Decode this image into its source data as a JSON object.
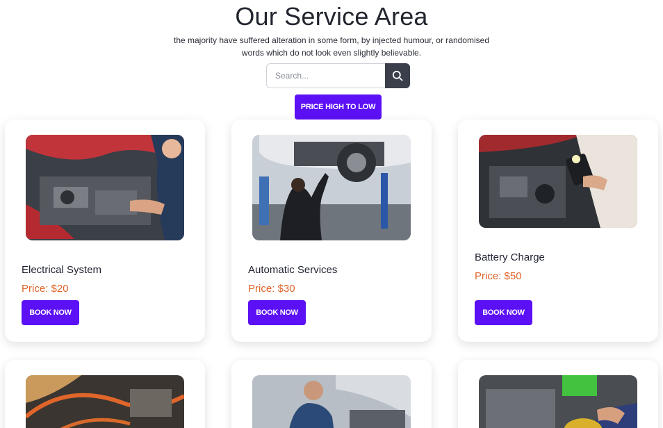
{
  "header": {
    "title": "Our Service Area",
    "subtitle": "the majority have suffered alteration in some form, by injected humour, or randomised words which do not look even slightly believable."
  },
  "search": {
    "placeholder": "Search..."
  },
  "sort": {
    "label": "PRICE HIGH TO LOW"
  },
  "services": [
    {
      "name": "Electrical System",
      "price": "Price: $20",
      "button": "BOOK NOW"
    },
    {
      "name": "Automatic Services",
      "price": "Price: $30",
      "button": "BOOK NOW"
    },
    {
      "name": "Battery Charge",
      "price": "Price: $50",
      "button": "BOOK NOW"
    }
  ],
  "colors": {
    "accent": "#5b10f5",
    "price": "#e0652a",
    "search_button": "#3a3f4b"
  }
}
